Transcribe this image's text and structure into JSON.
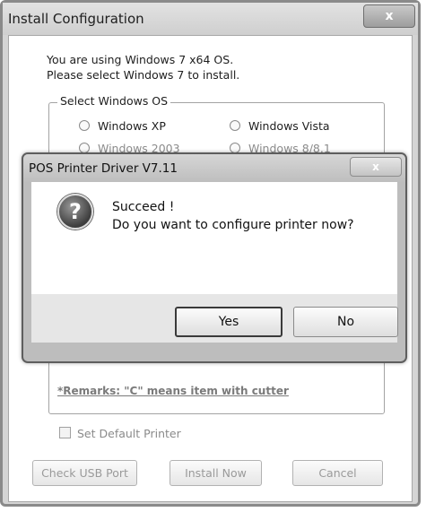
{
  "window": {
    "title": "Install Configuration",
    "close_glyph": "x",
    "info_lines": [
      "You are using Windows 7 x64 OS.",
      "Please select Windows 7 to install."
    ],
    "os_group": {
      "label": "Select Windows OS",
      "options": [
        "Windows XP",
        "Windows Vista",
        "Windows 2003",
        "Windows 8/8.1"
      ]
    },
    "remarks": "*Remarks: \"C\" means item with cutter",
    "default_printer_label": "Set Default Printer",
    "buttons": {
      "check_usb": "Check USB Port",
      "install_now": "Install Now",
      "cancel": "Cancel"
    }
  },
  "dialog": {
    "title": "POS Printer Driver V7.11",
    "close_glyph": "x",
    "icon": "question-icon",
    "message_lines": [
      "Succeed !",
      "Do you want to configure printer now?"
    ],
    "buttons": {
      "yes": "Yes",
      "no": "No"
    }
  },
  "colors": {
    "window_frame": "#8a8a8a",
    "dialog_frame": "#5e5e5e",
    "client_bg": "#ffffff",
    "disabled_text": "#9a9a9a"
  }
}
